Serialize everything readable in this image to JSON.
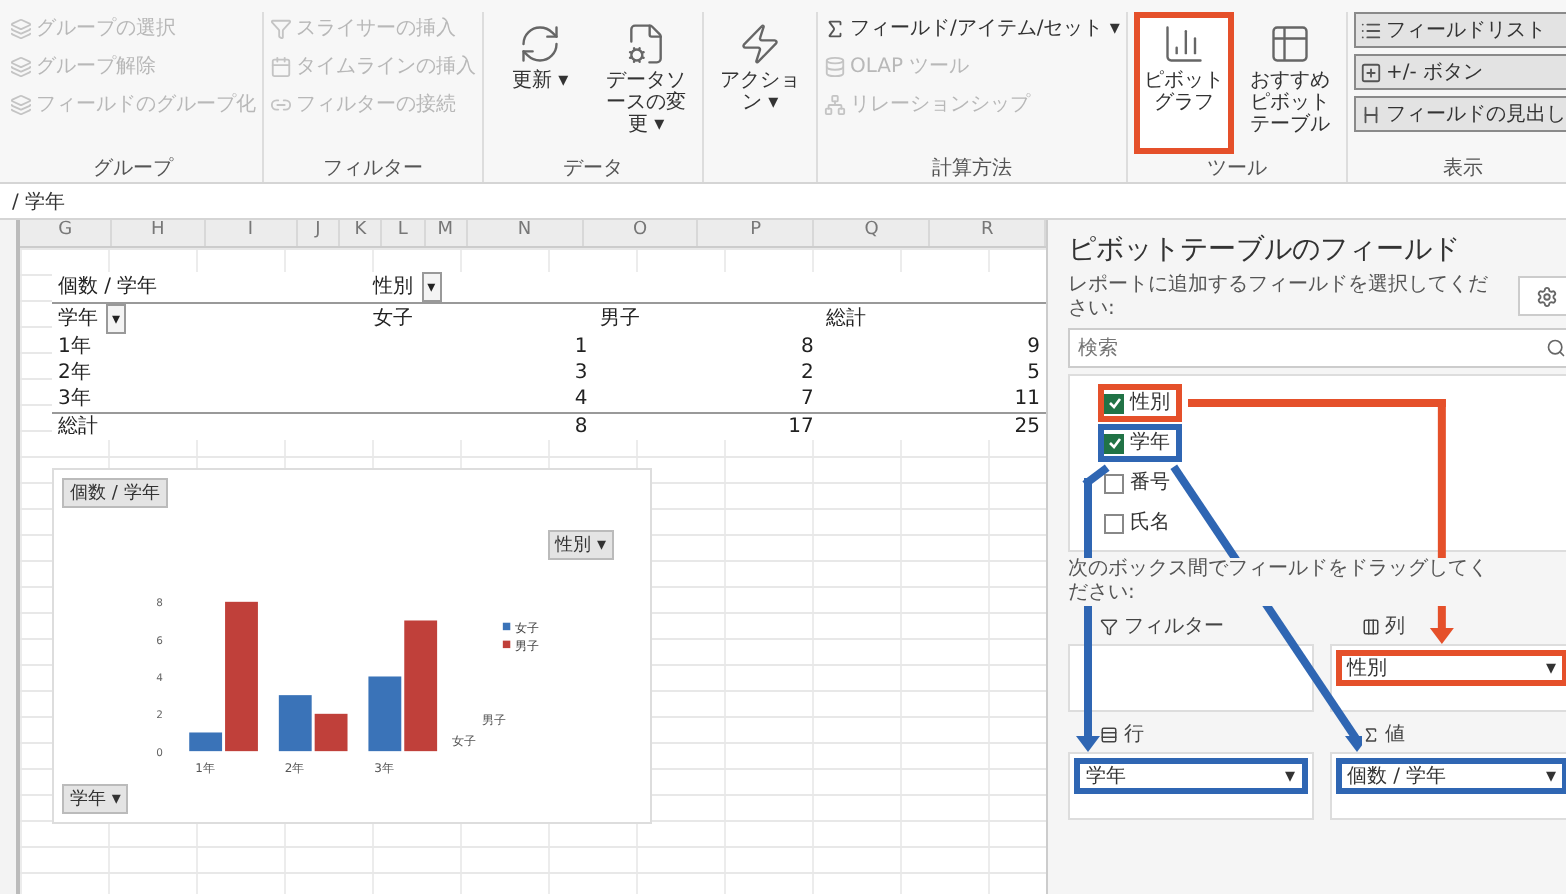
{
  "ribbon": {
    "groups": [
      {
        "label": "グループ",
        "items": [
          {
            "kind": "small",
            "label": "グループの選択",
            "disabled": true
          },
          {
            "kind": "small",
            "label": "グループ解除",
            "disabled": true
          },
          {
            "kind": "small",
            "label": "フィールドのグループ化",
            "disabled": true
          }
        ]
      },
      {
        "label": "フィルター",
        "items": [
          {
            "kind": "small",
            "label": "スライサーの挿入",
            "disabled": true
          },
          {
            "kind": "small",
            "label": "タイムラインの挿入",
            "disabled": true
          },
          {
            "kind": "small",
            "label": "フィルターの接続",
            "disabled": true
          }
        ]
      },
      {
        "label": "データ",
        "items": [
          {
            "kind": "large",
            "label": "更新",
            "caret": "▾",
            "disabled": false
          },
          {
            "kind": "large",
            "label": "データソースの変更",
            "caret": "▾",
            "disabled": false
          }
        ]
      },
      {
        "items": [
          {
            "kind": "large",
            "label": "アクション",
            "caret": "▾",
            "disabled": false
          }
        ]
      },
      {
        "label": "計算方法",
        "items": [
          {
            "kind": "small",
            "label": "フィールド/アイテム/セット",
            "caret": "▾",
            "disabled": false
          },
          {
            "kind": "small",
            "label": "OLAP ツール",
            "disabled": true
          },
          {
            "kind": "small",
            "label": "リレーションシップ",
            "disabled": true
          }
        ]
      },
      {
        "label": "ツール",
        "items": [
          {
            "kind": "large",
            "label": "ピボットグラフ",
            "disabled": false,
            "color": "#e5502a"
          },
          {
            "kind": "large",
            "label": "おすすめピボットテーブル",
            "disabled": false
          }
        ]
      },
      {
        "label": "表示",
        "items": [
          {
            "kind": "toggle",
            "label": "フィールドリスト",
            "selected": true
          },
          {
            "kind": "toggle",
            "label": "+/- ボタン",
            "selected": true
          },
          {
            "kind": "toggle",
            "label": "フィールドの見出し",
            "selected": true
          }
        ]
      }
    ]
  },
  "formula_bar": {
    "text": "/ 学年"
  },
  "sheet": {
    "columns": [
      "G",
      "H",
      "I",
      "J",
      "K",
      "L",
      "M",
      "N",
      "O",
      "P",
      "Q",
      "R"
    ],
    "pivot_table": {
      "value_field": "個数 / 学年",
      "column_field": "性別",
      "column_caret": "▾",
      "header": [
        "学年",
        "女子",
        "男子",
        "総計"
      ],
      "row_caret": "▾",
      "rows": [
        [
          "1年",
          "1",
          "8",
          "9"
        ],
        [
          "2年",
          "3",
          "2",
          "5"
        ],
        [
          "3年",
          "4",
          "7",
          "11"
        ],
        [
          "総計",
          "8",
          "17",
          "25"
        ]
      ]
    },
    "chart": {
      "value_button": "個数 / 学年",
      "axis_button": "学年 ▾",
      "legend_button": "性別 ▾",
      "chart_data": {
        "type": "bar",
        "legend": "right",
        "categories": [
          "1年",
          "2年",
          "3年"
        ],
        "yticks": [
          0,
          2,
          4,
          6,
          8
        ],
        "ylim": [
          0,
          8
        ],
        "series": [
          {
            "name": "女子",
            "color": "#3a73b8",
            "values": [
              1,
              3,
              4
            ]
          },
          {
            "name": "男子",
            "color": "#c0403a",
            "values": [
              8,
              2,
              7
            ]
          }
        ]
      }
    }
  },
  "field_panel": {
    "title": "ピボットテーブルのフィールド",
    "instruction": "レポートに追加するフィールドを選択してください:",
    "search_placeholder": "検索",
    "fields": [
      {
        "label": "性別",
        "checked": true,
        "color": "#e5502a"
      },
      {
        "label": "学年",
        "checked": true,
        "color": "#2f66b3"
      },
      {
        "label": "番号",
        "checked": false
      },
      {
        "label": "氏名",
        "checked": false
      }
    ],
    "areas_instruction": "次のボックス間でフィールドをドラッグしてください:",
    "areas": [
      {
        "kind": "filter",
        "label": "フィルター"
      },
      {
        "kind": "columns",
        "label": "列",
        "items": [
          {
            "label": "性別",
            "caret": "▾",
            "color": "#e5502a"
          }
        ]
      },
      {
        "kind": "rows",
        "label": "行",
        "items": [
          {
            "label": "学年",
            "caret": "▾",
            "color": "#2f66b3"
          }
        ]
      },
      {
        "kind": "values",
        "label": "値",
        "items": [
          {
            "label": "個数 / 学年",
            "caret": "▾",
            "color": "#2f66b3"
          }
        ]
      }
    ]
  }
}
